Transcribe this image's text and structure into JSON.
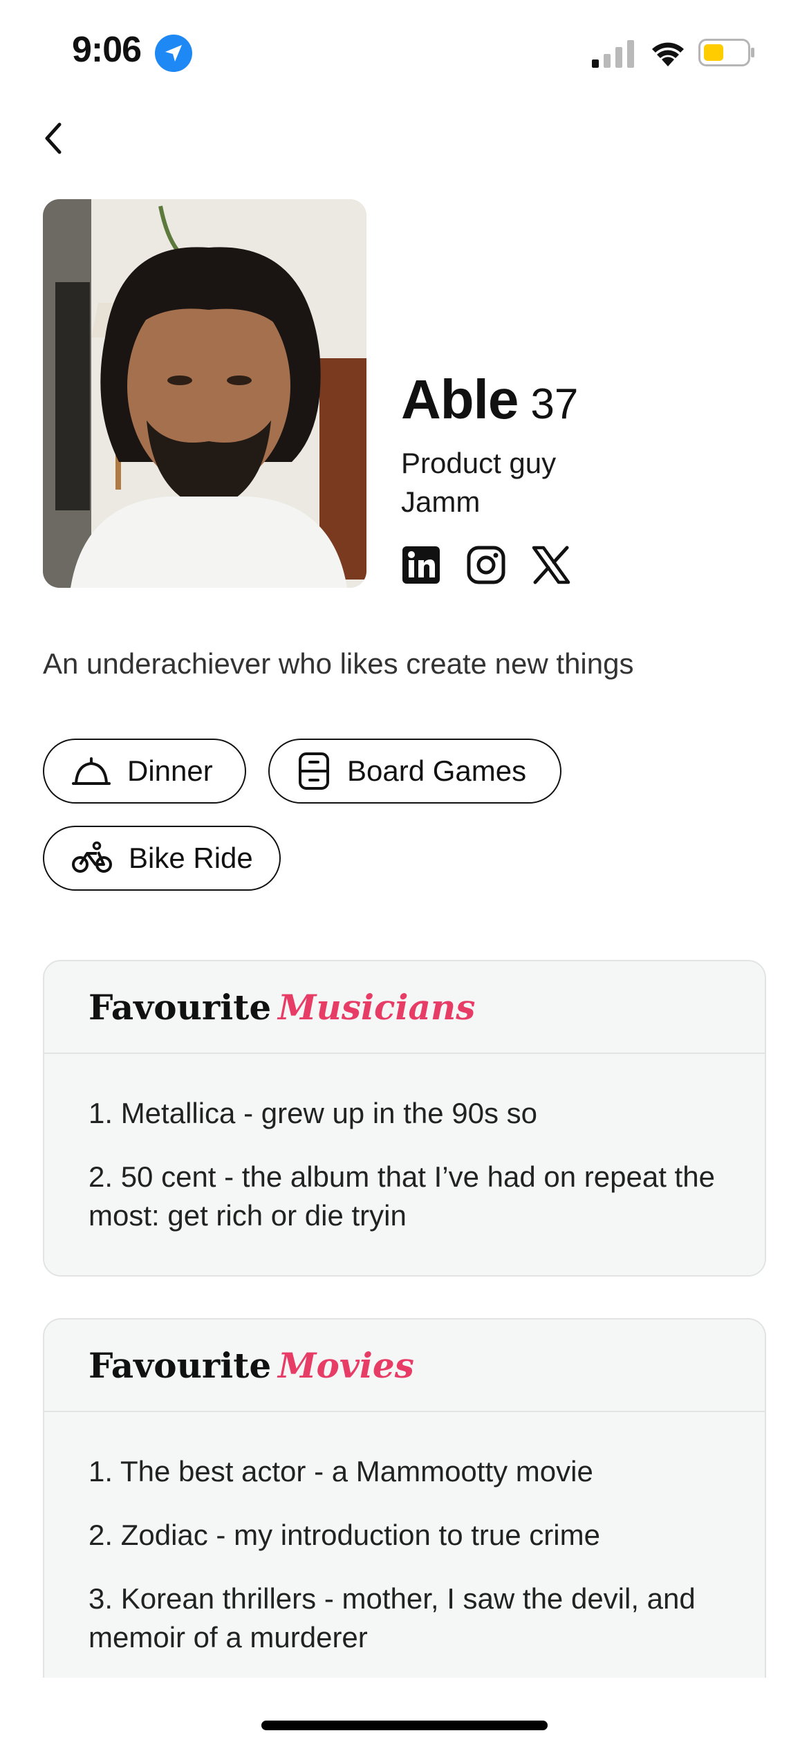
{
  "status_bar": {
    "time": "9:06"
  },
  "profile": {
    "name": "Able",
    "age": "37",
    "role": "Product guy",
    "company": "Jamm",
    "bio": "An underachiever who likes create new things"
  },
  "socials": [
    "linkedin-icon",
    "instagram-icon",
    "x-icon"
  ],
  "interests": [
    {
      "label": "Dinner",
      "icon": "cloche-icon"
    },
    {
      "label": "Board Games",
      "icon": "board-games-icon"
    },
    {
      "label": "Bike Ride",
      "icon": "bicycle-icon"
    }
  ],
  "cards": [
    {
      "title_plain": "Favourite",
      "title_accent": "Musicians",
      "items": [
        "1. Metallica - grew up in the 90s so",
        "2. 50 cent - the album that I’ve had on repeat the most: get rich or die tryin"
      ]
    },
    {
      "title_plain": "Favourite",
      "title_accent": "Movies",
      "items": [
        "1. The best actor - a Mammootty movie",
        "2. Zodiac - my introduction to true crime",
        "3. Korean thrillers - mother, I saw the devil, and memoir of a murderer"
      ]
    }
  ],
  "colors": {
    "accent": "#e63c65",
    "location": "#1e88f5",
    "battery": "#ffcc00",
    "card_bg": "#f5f6f6"
  }
}
